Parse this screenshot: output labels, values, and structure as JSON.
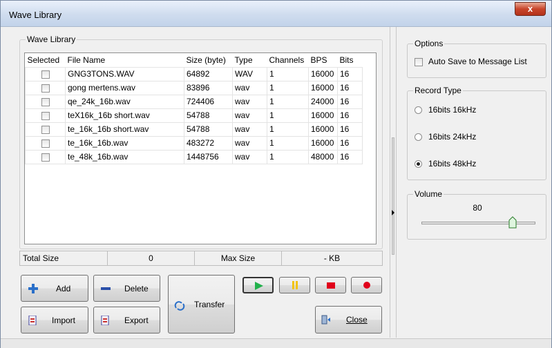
{
  "window": {
    "title": "Wave Library",
    "close_glyph": "x"
  },
  "library": {
    "group_label": "Wave Library",
    "columns": [
      "Selected",
      "File Name",
      "Size (byte)",
      "Type",
      "Channels",
      "BPS",
      "Bits"
    ],
    "rows": [
      {
        "file": "GNG3TONS.WAV",
        "size": "64892",
        "type": "WAV",
        "channels": "1",
        "bps": "16000",
        "bits": "16"
      },
      {
        "file": "gong mertens.wav",
        "size": "83896",
        "type": "wav",
        "channels": "1",
        "bps": "16000",
        "bits": "16"
      },
      {
        "file": "qe_24k_16b.wav",
        "size": "724406",
        "type": "wav",
        "channels": "1",
        "bps": "24000",
        "bits": "16"
      },
      {
        "file": "teX16k_16b short.wav",
        "size": "54788",
        "type": "wav",
        "channels": "1",
        "bps": "16000",
        "bits": "16"
      },
      {
        "file": "te_16k_16b short.wav",
        "size": "54788",
        "type": "wav",
        "channels": "1",
        "bps": "16000",
        "bits": "16"
      },
      {
        "file": "te_16k_16b.wav",
        "size": "483272",
        "type": "wav",
        "channels": "1",
        "bps": "16000",
        "bits": "16"
      },
      {
        "file": "te_48k_16b.wav",
        "size": "1448756",
        "type": "wav",
        "channels": "1",
        "bps": "48000",
        "bits": "16"
      }
    ]
  },
  "status": {
    "total_label": "Total Size",
    "total_value": "0",
    "max_label": "Max Size",
    "max_value": "- KB"
  },
  "buttons": {
    "add": "Add",
    "delete": "Delete",
    "import": "Import",
    "export": "Export",
    "transfer": "Transfer",
    "close": "Close"
  },
  "options": {
    "group_label": "Options",
    "auto_save_label": "Auto Save to Message List",
    "auto_save_checked": false
  },
  "record_type": {
    "group_label": "Record Type",
    "choices": [
      "16bits 16kHz",
      "16bits 24kHz",
      "16bits 48kHz"
    ],
    "selected": "16bits 48kHz"
  },
  "volume": {
    "group_label": "Volume",
    "value": "80",
    "level_fraction": 0.8
  },
  "colors": {
    "play_green": "#22b14c",
    "pause_yellow": "#f2c300",
    "stop_red": "#e0001b",
    "record_red": "#e0001b",
    "accent_blue": "#2a6fc9"
  },
  "icons": {
    "add": "plus-icon",
    "delete": "minus-icon",
    "import": "import-icon",
    "export": "export-icon",
    "transfer": "transfer-icon",
    "close": "door-exit-icon",
    "play": "play-icon",
    "pause": "pause-icon",
    "stop": "stop-icon",
    "record": "record-icon"
  }
}
